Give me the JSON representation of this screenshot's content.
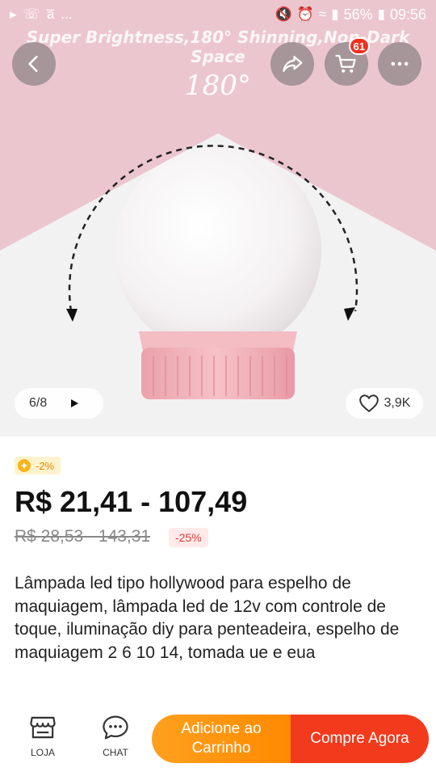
{
  "status_bar": {
    "left_icons": [
      "play-arrow-icon",
      "whatsapp-icon",
      "amazon-icon",
      "more-dots-icon"
    ],
    "dots": "...",
    "battery": "56%",
    "time": "09:56"
  },
  "image": {
    "banner_text": "Super Brightness,180° Shinning,Non-Dark Space",
    "degree_label": "180°",
    "counter": "6/8",
    "likes": "3,9K",
    "colors": {
      "pink": "#ecc6cf",
      "white": "#f2f2f2",
      "bulb_base": "#f3b3bb"
    }
  },
  "header": {
    "cart_count": "61"
  },
  "product": {
    "coupon": "-2%",
    "price": "R$ 21,41 - 107,49",
    "old_price": "R$ 28,53 - 143,31",
    "discount": "-25%",
    "title": "Lâmpada led tipo hollywood para espelho de maquiagem, lâmpada led de 12v com controle de toque, iluminação diy para penteadeira, espelho de maquiagem 2 6 10 14, tomada ue e eua"
  },
  "bottom_bar": {
    "store_label": "LOJA",
    "chat_label": "CHAT",
    "add_to_cart": "Adicione ao Carrinho",
    "buy_now": "Compre Agora",
    "colors": {
      "orange": "#ff8a00",
      "red": "#f23a1d"
    }
  }
}
